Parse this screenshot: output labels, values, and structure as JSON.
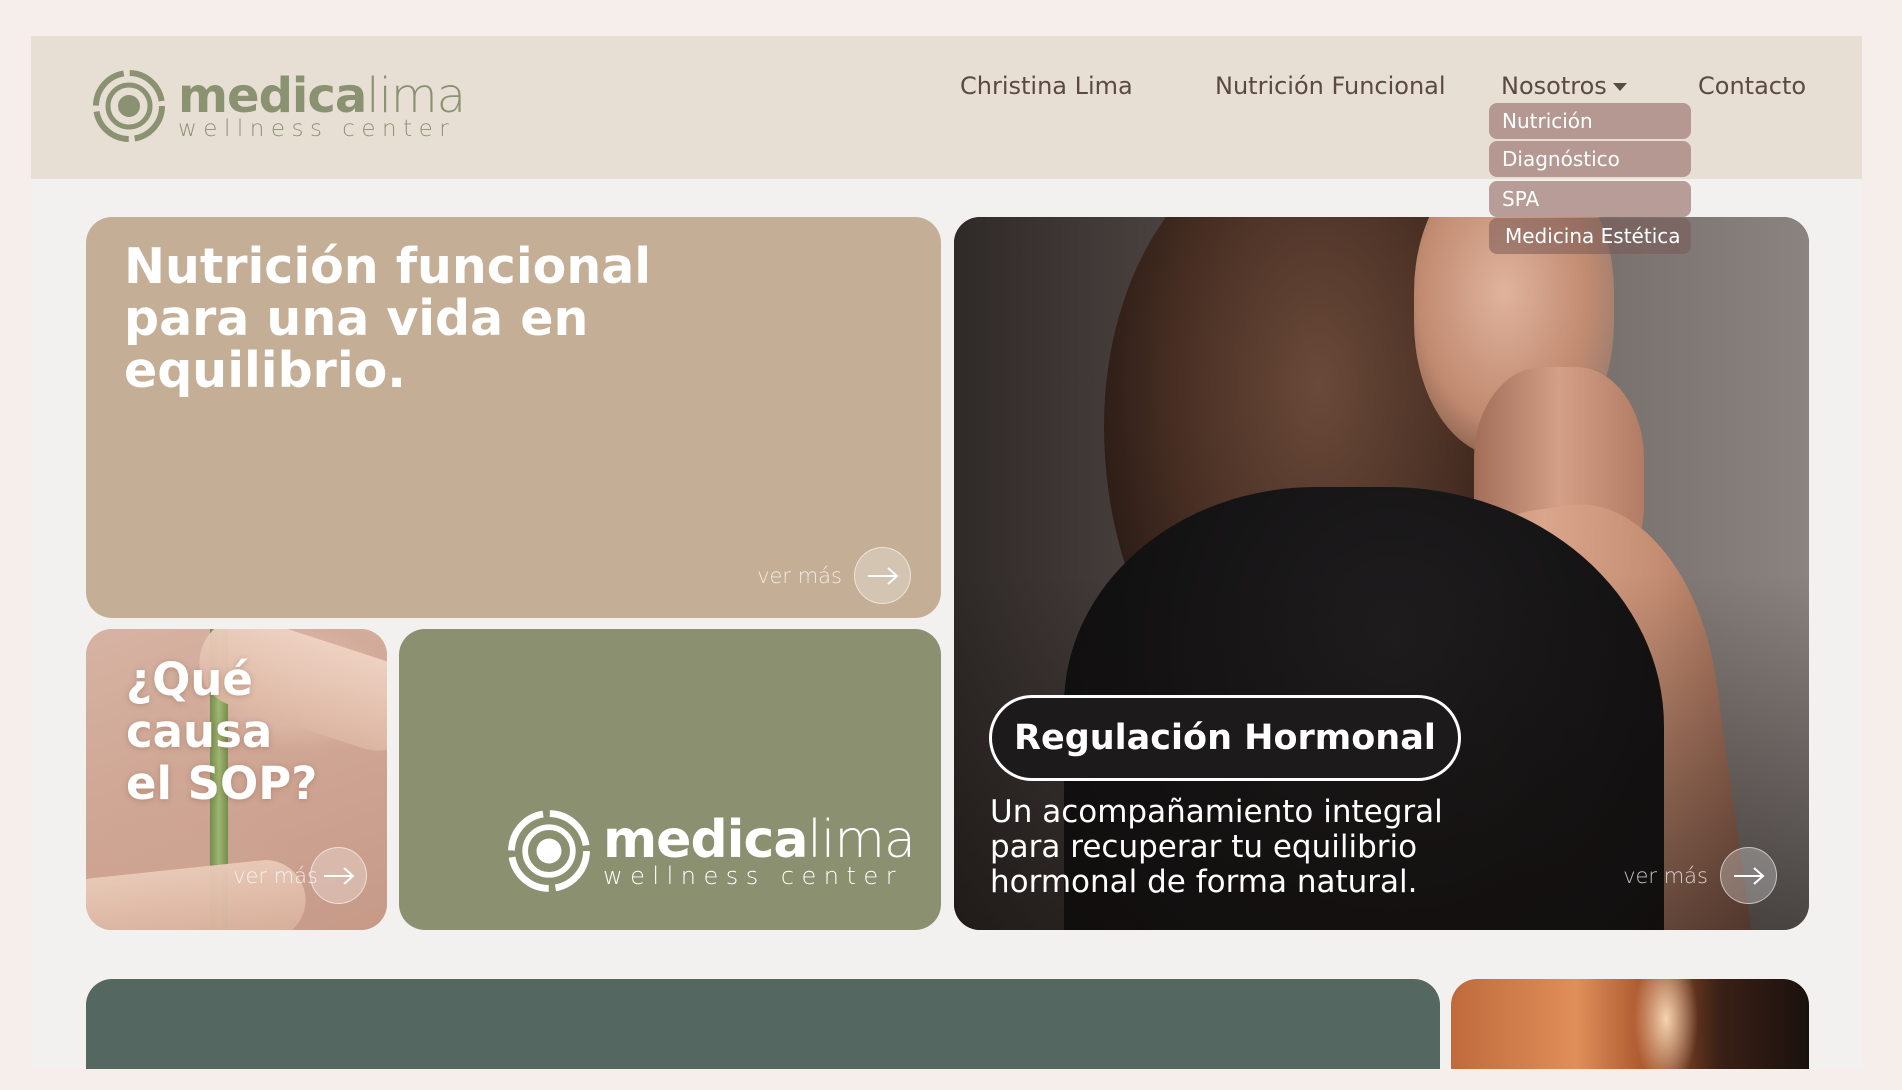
{
  "header": {
    "logo": {
      "main_bold": "medica",
      "main_light": "lima",
      "sub": "wellness center"
    },
    "nav": [
      {
        "label": "Christina Lima"
      },
      {
        "label": "Nutrición Funcional"
      },
      {
        "label": "Nosotros"
      },
      {
        "label": "Contacto"
      }
    ],
    "dropdown": [
      "Nutrición",
      "Diagnóstico",
      "SPA",
      "Medicina Estética"
    ]
  },
  "cards": {
    "nutricion": {
      "title": "Nutrición funcional para una vida en equilibrio.",
      "ver_mas": "ver más"
    },
    "sop": {
      "title_line1": "¿Qué",
      "title_line2": "causa",
      "title_line3": "el SOP?",
      "ver_mas": "ver más"
    },
    "brand": {
      "main_bold": "medica",
      "main_light": "lima",
      "sub": "wellness center"
    },
    "hormonal": {
      "pill": "Regulación Hormonal",
      "desc": "Un acompañamiento integral para recuperar tu equilibrio hormonal de forma natural.",
      "ver_mas": "ver más"
    }
  },
  "colors": {
    "header_bg": "#e8dfd4",
    "brand_green": "#8a9272",
    "nutri_card": "#c4ae95",
    "logo_card": "#8b9170",
    "dropdown_bg": "#aa8982",
    "bottom_card": "#546761"
  }
}
